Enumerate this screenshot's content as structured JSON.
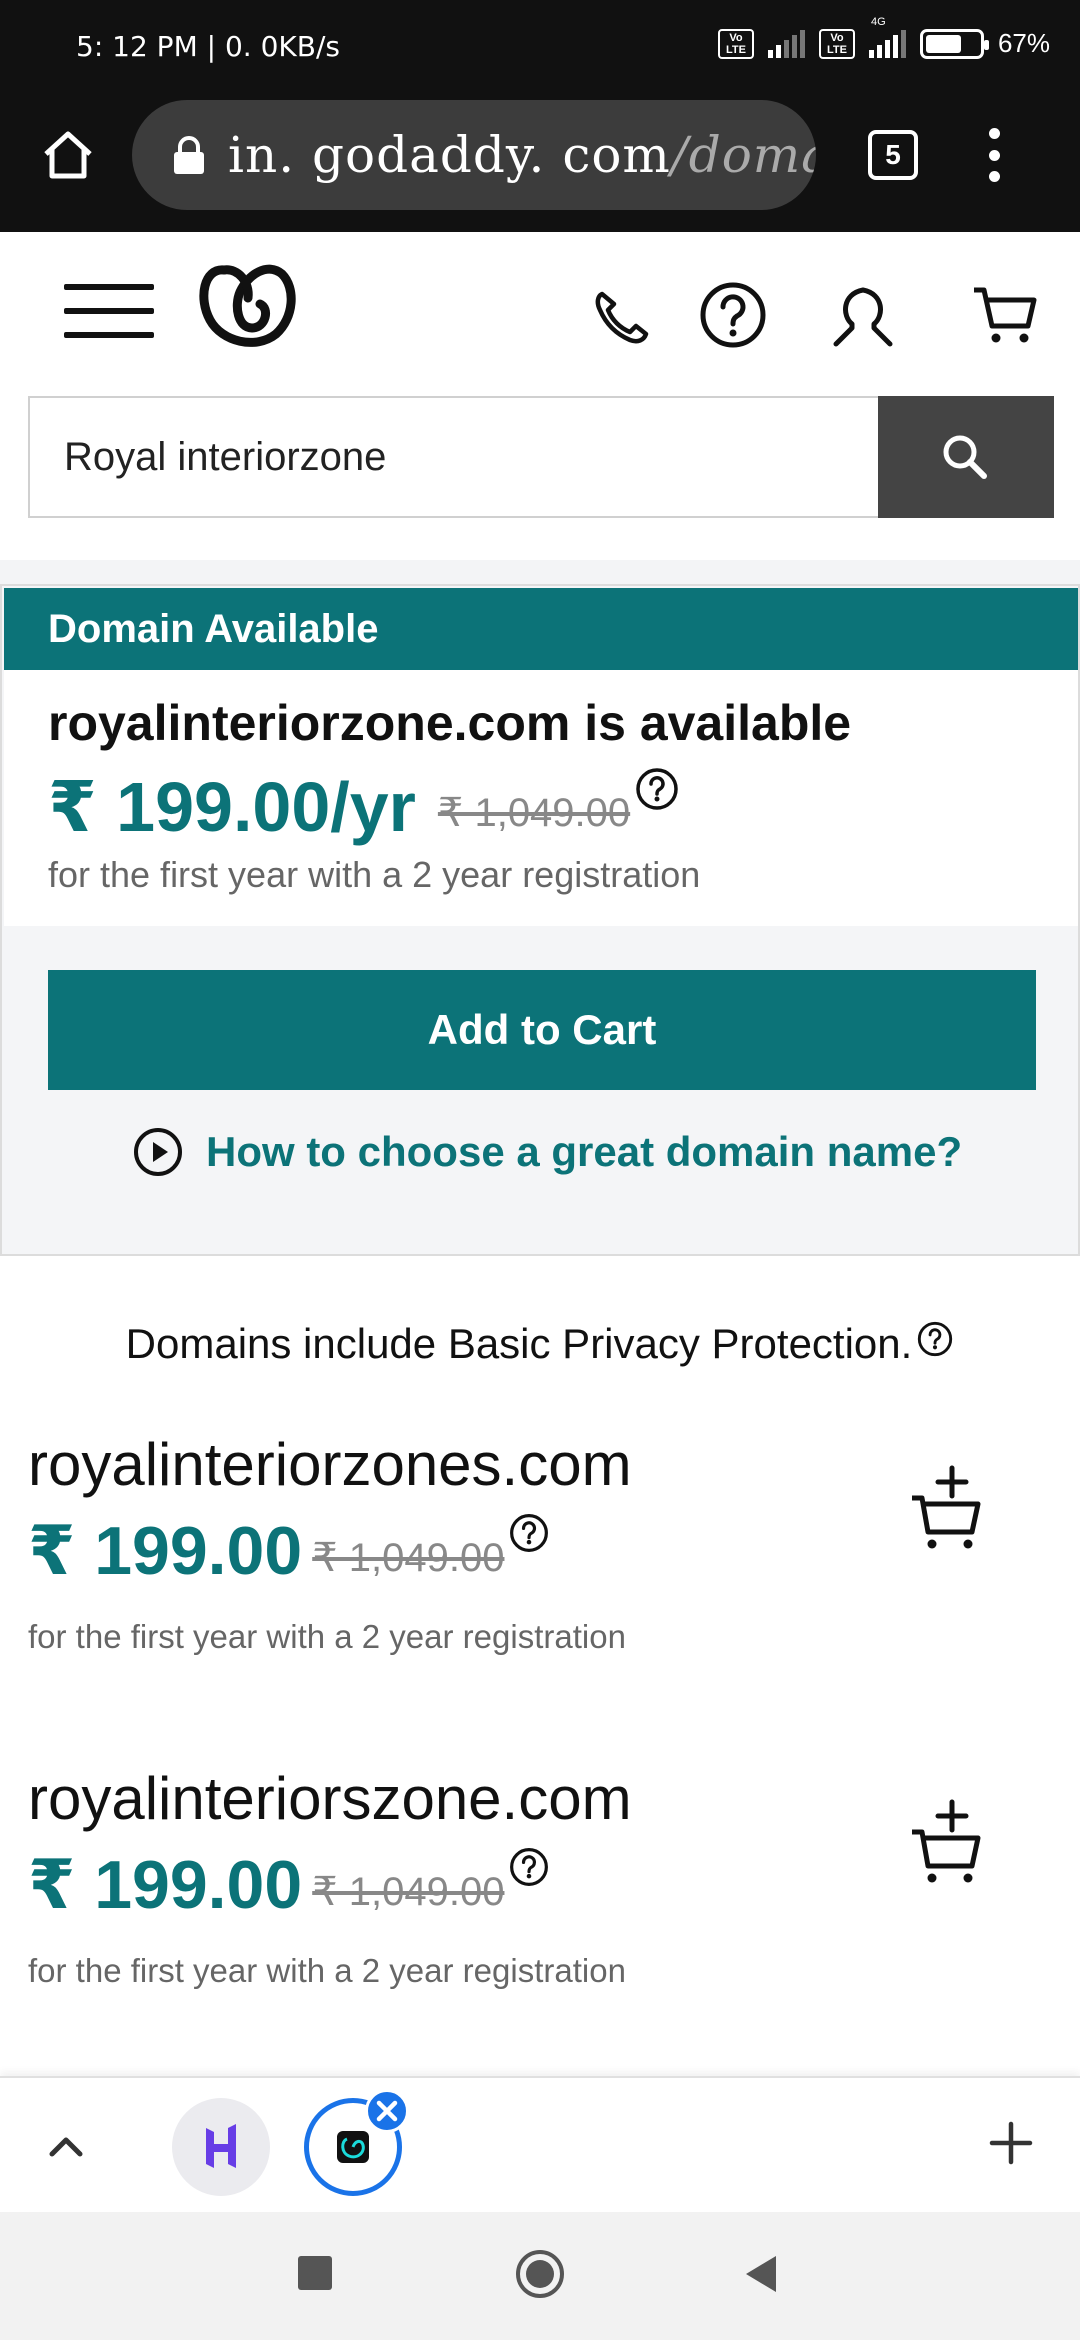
{
  "status_bar": {
    "time": "5: 12 PM | 0. 0KB/s",
    "network1": "Vo LTE",
    "network2": "Vo LTE",
    "network_type": "4G",
    "battery": "67%",
    "battery_level": 0.67
  },
  "browser": {
    "url_host": "in. godaddy. com",
    "url_path": "/domain",
    "tab_count": "5"
  },
  "search": {
    "value": "Royal interiorzone",
    "icon": "search-icon"
  },
  "availability": {
    "banner": "Domain Available",
    "title": "royalinteriorzone.com is available",
    "price": "₹ 199.00/yr",
    "old_price": "₹ 1,049.00",
    "note": "for the first year with a 2 year registration",
    "add_to_cart": "Add to Cart",
    "howto": "How to choose a great domain name?"
  },
  "privacy_text": "Domains include Basic Privacy Protection.",
  "suggestions": [
    {
      "name": "royalinteriorzones.com",
      "price": "₹ 199.00",
      "old_price": "₹ 1,049.00",
      "note": "for the first year with a 2 year registration"
    },
    {
      "name": "royalinteriorszone.com",
      "price": "₹ 199.00",
      "old_price": "₹ 1,049.00",
      "note": "for the first year with a 2 year registration"
    }
  ],
  "colors": {
    "brand_teal": "#0c7378",
    "search_button": "#444444",
    "tab_accent": "#1a73e8",
    "hostinger_purple": "#673de6"
  }
}
